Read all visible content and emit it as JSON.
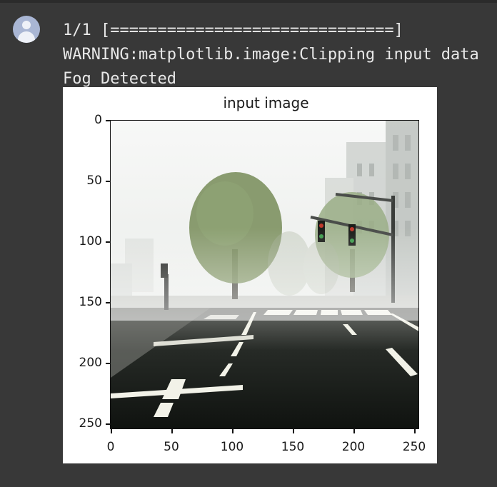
{
  "output": {
    "progress_line": "1/1 [==============================]",
    "warning_line": "WARNING:matplotlib.image:Clipping input data",
    "result_line": "Fog Detected"
  },
  "chart_data": {
    "type": "image",
    "title": "input image",
    "x_ticks": [
      "0",
      "50",
      "100",
      "150",
      "200",
      "250"
    ],
    "y_ticks": [
      "0",
      "50",
      "100",
      "150",
      "200",
      "250"
    ],
    "xlim": [
      0,
      256
    ],
    "ylim": [
      256,
      0
    ],
    "content": "foggy street with road markings, trees, traffic lights and buildings"
  },
  "icons": {
    "avatar": "user-avatar-icon"
  },
  "colors": {
    "background": "#383838",
    "text": "#e8e8e8",
    "avatar": "#a9b6d4"
  }
}
